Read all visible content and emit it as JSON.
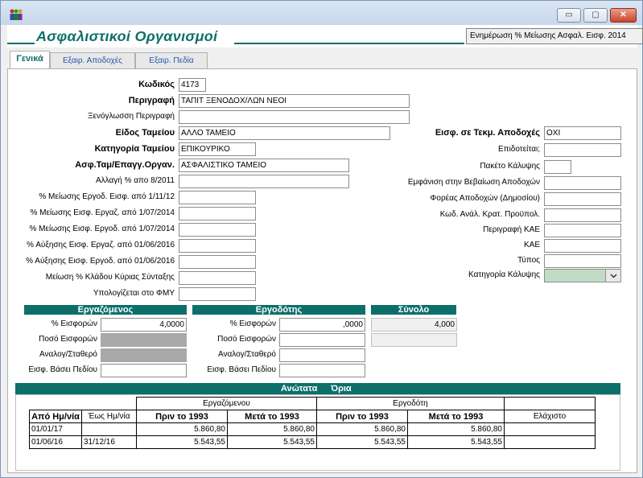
{
  "window": {
    "minimize_glyph": "▭",
    "maximize_glyph": "▢",
    "close_glyph": "✕"
  },
  "header": {
    "title": "Ασφαλιστικοί Οργανισμοί",
    "action": "Ενημέρωση % Μείωσης  Ασφαλ. Εισφ. 2014"
  },
  "tabs": [
    "Γενικά",
    "Εξαιρ. Αποδοχές",
    "Εξαιρ. Πεδία"
  ],
  "left_fields": [
    {
      "label": "Κωδικός",
      "value": "4173"
    },
    {
      "label": "Περιγραφή",
      "value": "ΤΑΠΙΤ ΞΕΝΟΔΟΧ/ΛΩΝ ΝΕΟΙ"
    },
    {
      "label": "Ξενόγλωσση Περιγραφή",
      "value": ""
    },
    {
      "label": "Είδος Ταμείου",
      "value": "ΑΛΛΟ ΤΑΜΕΙΟ"
    },
    {
      "label": "Κατηγορία Ταμείου",
      "value": "ΕΠΙΚΟΥΡΙΚΟ"
    },
    {
      "label": "Ασφ.Ταμ/Επαγγ.Οργαν.",
      "value": "ΑΣΦΑΛΙΣΤΙΚΟ ΤΑΜΕΙΟ"
    },
    {
      "label": "Αλλαγή % απο 8/2011",
      "value": ""
    },
    {
      "label": "% Μείωσης Εργοδ. Εισφ. από 1/11/12",
      "value": ""
    },
    {
      "label": "% Μείωσης Εισφ. Εργαζ. από 1/07/2014",
      "value": ""
    },
    {
      "label": "% Μείωσης Εισφ. Εργοδ. από 1/07/2014",
      "value": ""
    },
    {
      "label": "% Αύξησης Εισφ. Εργαζ. από 01/06/2016",
      "value": ""
    },
    {
      "label": "% Αύξησης Εισφ. Εργοδ. από 01/06/2016",
      "value": ""
    },
    {
      "label": "Μείωση % Κλάδου Κύριας Σύνταξης",
      "value": ""
    },
    {
      "label": "Υπολογίζεται στο ΦΜΥ",
      "value": ""
    }
  ],
  "right_fields": [
    {
      "label": "Εισφ. σε Τεκμ. Αποδοχές",
      "value": "ΟΧΙ"
    },
    {
      "label": "Επιδοτείται;",
      "value": ""
    },
    {
      "label": "Πακέτο Κάλυψης",
      "value": ""
    },
    {
      "label": "Εμφάνιση στην Βεβαίωση Αποδοχών",
      "value": ""
    },
    {
      "label": "Φορέας Αποδοχών (Δημοσίου)",
      "value": ""
    },
    {
      "label": "Κωδ. Ανάλ. Κρατ. Προϋπολ.",
      "value": ""
    },
    {
      "label": "Περιγραφή ΚΑΕ",
      "value": ""
    },
    {
      "label": "ΚΑΕ",
      "value": ""
    },
    {
      "label": "Τύπος",
      "value": ""
    },
    {
      "label": "Κατηγορία Κάλυψης",
      "value": ""
    }
  ],
  "employee": {
    "title": "Εργαζόμενος",
    "labels": [
      "% Εισφορών",
      "Ποσό Εισφορών",
      "Αναλογ/Σταθερό",
      "Εισφ. Βάσει Πεδίου"
    ],
    "pct": "4,0000"
  },
  "employer": {
    "title": "Εργοδότης",
    "labels": [
      "% Εισφορών",
      "Ποσό Εισφορών",
      "Αναλογ/Σταθερό",
      "Εισφ. Βάσει Πεδίου"
    ],
    "pct": ",0000"
  },
  "total": {
    "title": "Σύνολο",
    "value": "4,000"
  },
  "limits": {
    "title_a": "Ανώτατα",
    "title_b": "Όρια",
    "group_employee": "Εργαζόμενου",
    "group_employer": "Εργοδότη",
    "headers": [
      "Από Ημ/νία",
      "Έως Ημ/νία",
      "Πριν το 1993",
      "Μετά το 1993",
      "Πριν το 1993",
      "Μετά το 1993",
      "Ελάχιστο"
    ],
    "rows": [
      [
        "01/01/17",
        "",
        "5.860,80",
        "5.860,80",
        "5.860,80",
        "5.860,80",
        ""
      ],
      [
        "01/06/16",
        "31/12/16",
        "5.543,55",
        "5.543,55",
        "5.543,55",
        "5.543,55",
        ""
      ]
    ]
  }
}
